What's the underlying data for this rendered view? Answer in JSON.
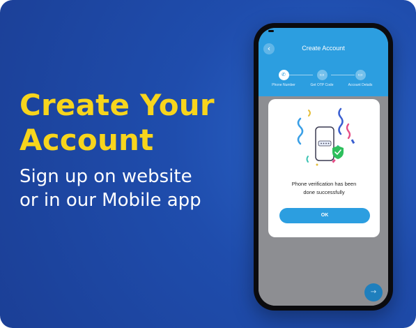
{
  "promo": {
    "headline_line1": "Create Your",
    "headline_line2": "Account",
    "sub_line1": "Sign up on website",
    "sub_line2": "or in our Mobile app"
  },
  "app": {
    "title": "Create Account",
    "back_icon": "chevron-left-icon",
    "steps": [
      {
        "label": "Phone Number",
        "icon": "phone-icon",
        "active": true
      },
      {
        "label": "Get OTP Code",
        "icon": "card-icon",
        "active": false
      },
      {
        "label": "Account Details",
        "icon": "card-icon",
        "active": false
      }
    ],
    "dialog": {
      "message_line1": "Phone verification has been",
      "message_line2": "done successfully",
      "ok_label": "OK"
    },
    "fab_icon": "arrow-right-icon"
  },
  "colors": {
    "background": "#1f4dad",
    "headline": "#f7d51c",
    "app_primary": "#2c9ee0",
    "check_green": "#2dbf5c"
  }
}
